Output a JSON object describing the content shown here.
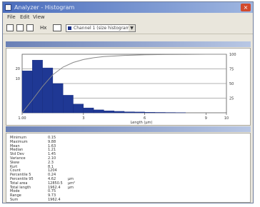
{
  "window": {
    "title": "Analyzer - Histogram",
    "close_glyph": "×"
  },
  "menu": [
    "File",
    "Edit",
    "View"
  ],
  "toolbar": {
    "buttons": [
      "open-icon",
      "square-icon",
      "copy-icon"
    ],
    "mode_label": "Hx",
    "selector_value": "Channel 1 (size histogram)",
    "selector_arrow": "▼"
  },
  "chart_panel": {
    "heading": ""
  },
  "stats_panel": {
    "heading": ""
  },
  "chart_data": {
    "type": "bar",
    "xlim": [
      0,
      10
    ],
    "ylim_left": [
      0,
      60
    ],
    "ylim_right": [
      0,
      100
    ],
    "bins_x": [
      0.5,
      1.0,
      1.5,
      2.0,
      2.5,
      3.0,
      3.5,
      4.0,
      4.5,
      5.0,
      5.5,
      6.0,
      6.5,
      7.0,
      7.5,
      8.0
    ],
    "values": [
      43,
      54,
      46,
      30,
      18,
      9,
      5,
      3,
      2,
      1.5,
      1,
      0.8,
      0.5,
      0.4,
      0.3,
      0.2
    ],
    "cumulative_line": {
      "x": [
        0,
        0.5,
        1,
        1.5,
        2,
        2.5,
        3,
        3.5,
        4,
        4.5,
        5,
        5.5,
        6,
        7,
        8,
        9,
        10
      ],
      "y": [
        0,
        22,
        45,
        65,
        78,
        86,
        91,
        94,
        96,
        97,
        98,
        98.5,
        99,
        99.5,
        99.8,
        100,
        100
      ]
    },
    "x_tick_labels": [
      "1.00",
      "3",
      "6",
      "9",
      "10"
    ],
    "x_tick_positions": [
      0,
      3,
      6,
      9,
      10
    ],
    "left_tick_labels": [
      "20",
      "10"
    ],
    "right_tick_labels": [
      "100",
      "75",
      "50",
      "25"
    ],
    "xlabel": "Length (µm)",
    "grid": true,
    "bar_color": "#1f3894",
    "line_color": "#8a8a8a"
  },
  "stats_rows": [
    {
      "label": "Minimum",
      "value": "0.15",
      "unit": ""
    },
    {
      "label": "Maximum",
      "value": "9.88",
      "unit": ""
    },
    {
      "label": "Mean",
      "value": "1.63",
      "unit": ""
    },
    {
      "label": "Median",
      "value": "1.21",
      "unit": ""
    },
    {
      "label": "Std Dev",
      "value": "1.45",
      "unit": ""
    },
    {
      "label": "Variance",
      "value": "2.10",
      "unit": ""
    },
    {
      "label": "Skew",
      "value": "2.3",
      "unit": ""
    },
    {
      "label": "Kurt",
      "value": "8.1",
      "unit": ""
    },
    {
      "label": "Count",
      "value": "1204",
      "unit": ""
    },
    {
      "label": "Percentile 5",
      "value": "0.24",
      "unit": ""
    },
    {
      "label": "Percentile 95",
      "value": "4.62",
      "unit": "µm"
    },
    {
      "label": "Total area",
      "value": "12850.5",
      "unit": "µm²"
    },
    {
      "label": "Total length",
      "value": "1962.4",
      "unit": "µm"
    },
    {
      "label": "Mode",
      "value": "0.75",
      "unit": ""
    },
    {
      "label": "Range",
      "value": "9.73",
      "unit": ""
    },
    {
      "label": "Sum",
      "value": "1962.4",
      "unit": ""
    }
  ]
}
